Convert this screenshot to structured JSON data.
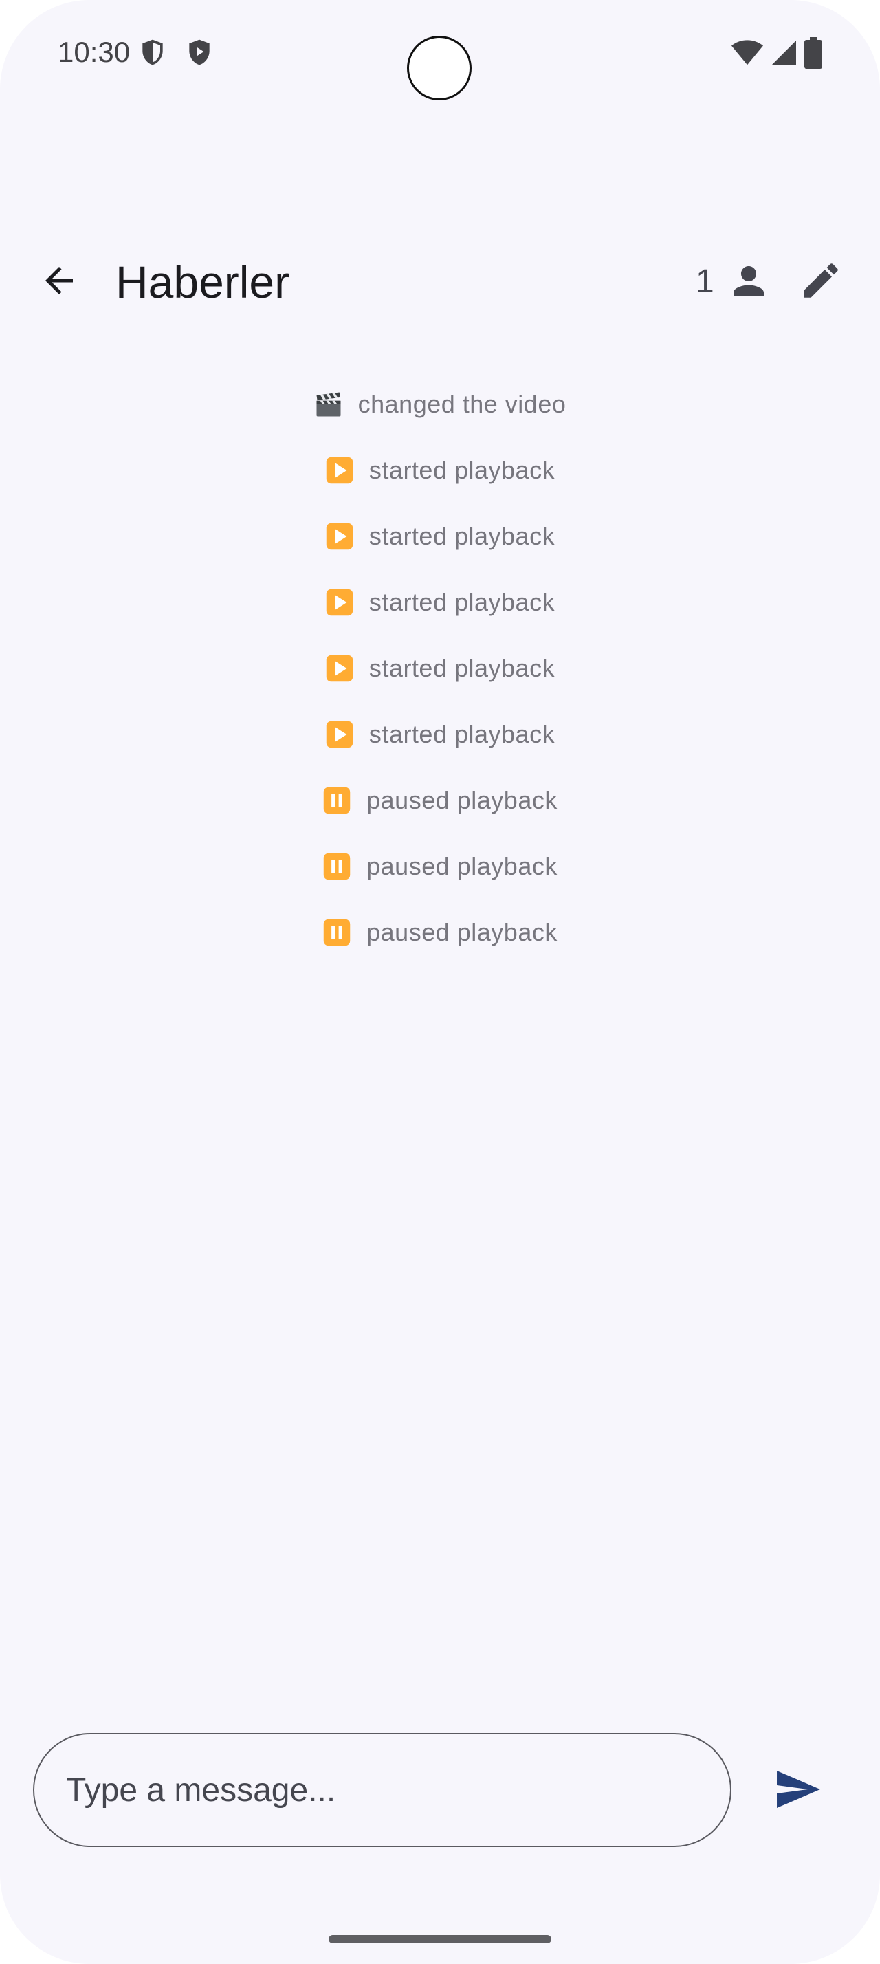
{
  "status_bar": {
    "time": "10:30",
    "left_icons": [
      "vpn-shield-icon",
      "play-protect-icon"
    ],
    "right_icons": [
      "wifi-icon",
      "cellular-signal-icon",
      "battery-icon"
    ]
  },
  "app_bar": {
    "title": "Haberler",
    "member_count": "1",
    "icons": [
      "back-arrow-icon",
      "person-icon",
      "edit-pencil-icon"
    ]
  },
  "events": [
    {
      "icon": "clapper-board-icon",
      "text": "changed the video"
    },
    {
      "icon": "play-icon",
      "text": "started playback"
    },
    {
      "icon": "play-icon",
      "text": "started playback"
    },
    {
      "icon": "play-icon",
      "text": "started playback"
    },
    {
      "icon": "play-icon",
      "text": "started playback"
    },
    {
      "icon": "play-icon",
      "text": "started playback"
    },
    {
      "icon": "pause-icon",
      "text": "paused playback"
    },
    {
      "icon": "pause-icon",
      "text": "paused playback"
    },
    {
      "icon": "pause-icon",
      "text": "paused playback"
    }
  ],
  "composer": {
    "placeholder": "Type a message...",
    "value": "",
    "send_icon": "send-icon"
  },
  "colors": {
    "background": "#f7f6fc",
    "accent": "#25407a",
    "event_text": "#77767e",
    "emoji_orange": "#ffac33"
  }
}
